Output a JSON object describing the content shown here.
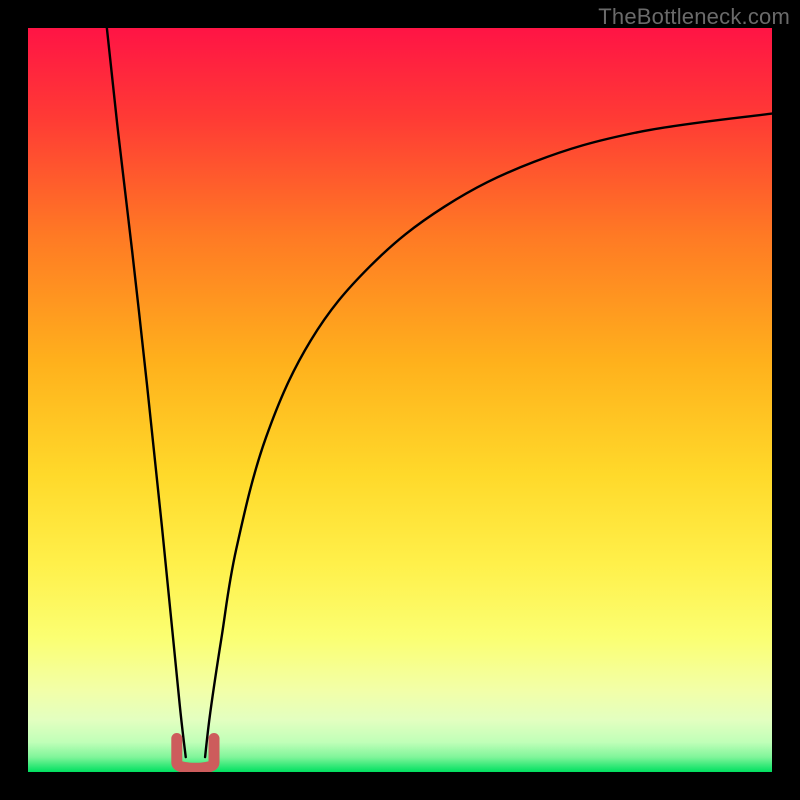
{
  "watermark": "TheBottleneck.com",
  "chart_data": {
    "type": "line",
    "title": "",
    "xlabel": "",
    "ylabel": "",
    "xlim": [
      0,
      100
    ],
    "ylim": [
      0,
      100
    ],
    "grid": false,
    "legend": false,
    "background_gradient": {
      "top_color": "#ff1445",
      "mid_colors": [
        "#ff5b2a",
        "#ffb81f",
        "#fff04a",
        "#f8ff8e",
        "#d7ffcc"
      ],
      "bottom_color": "#00e060"
    },
    "series": [
      {
        "name": "left-branch",
        "x": [
          10.6,
          12,
          14,
          16,
          18,
          19.5,
          20.5,
          21.2
        ],
        "y": [
          100,
          87,
          70,
          52,
          33,
          18,
          8,
          2
        ]
      },
      {
        "name": "right-branch",
        "x": [
          23.8,
          24.5,
          26,
          28,
          32,
          38,
          46,
          56,
          68,
          82,
          100
        ],
        "y": [
          2,
          8,
          18,
          30,
          45,
          58,
          68,
          76,
          82,
          86,
          88.5
        ]
      }
    ],
    "marker": {
      "name": "U-bottom",
      "shape": "U",
      "color": "#cd5c5c",
      "x_center": 22.5,
      "y_center": 2.5,
      "width": 5,
      "height": 4
    }
  }
}
